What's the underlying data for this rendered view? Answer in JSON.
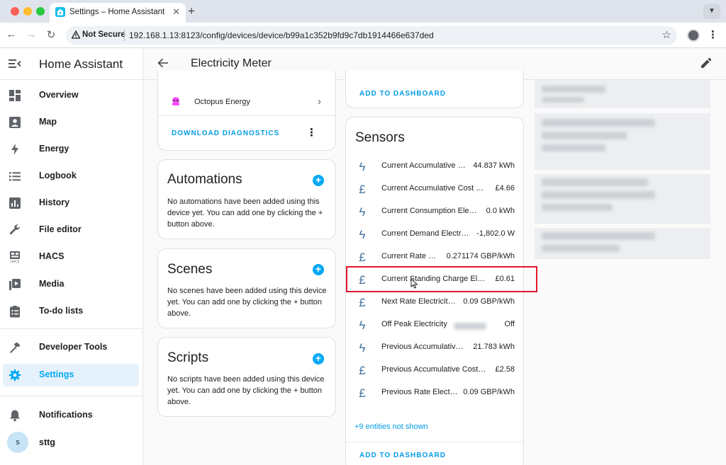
{
  "browser": {
    "tab_title": "Settings – Home Assistant",
    "new_tab": "+",
    "close_tab": "✕",
    "security_label": "Not Secure",
    "url": "192.168.1.13:8123/config/devices/device/b99a1c352b9fd9c7db1914466e637ded"
  },
  "sidebar": {
    "app_title": "Home Assistant",
    "items": [
      {
        "label": "Overview",
        "icon": "view-dashboard-icon"
      },
      {
        "label": "Map",
        "icon": "map-account-icon"
      },
      {
        "label": "Energy",
        "icon": "lightning-icon"
      },
      {
        "label": "Logbook",
        "icon": "format-list-icon"
      },
      {
        "label": "History",
        "icon": "chart-box-icon"
      },
      {
        "label": "File editor",
        "icon": "wrench-icon"
      },
      {
        "label": "HACS",
        "icon": "hacs-icon"
      },
      {
        "label": "Media",
        "icon": "play-box-multiple-icon"
      },
      {
        "label": "To-do lists",
        "icon": "clipboard-list-icon"
      }
    ],
    "developer_tools": "Developer Tools",
    "settings": "Settings",
    "notifications": "Notifications",
    "user_initial": "s",
    "user_name": "sttg"
  },
  "header": {
    "title": "Electricity Meter"
  },
  "device_card": {
    "integration": "Octopus Energy",
    "download_diagnostics": "DOWNLOAD DIAGNOSTICS"
  },
  "automations": {
    "title": "Automations",
    "text": "No automations have been added using this device yet. You can add one by clicking the + button above."
  },
  "scenes": {
    "title": "Scenes",
    "text": "No scenes have been added using this device yet. You can add one by clicking the + button above."
  },
  "scripts": {
    "title": "Scripts",
    "text": "No scripts have been added using this device yet. You can add one by clicking the + button above."
  },
  "top_card": {
    "add_to_dashboard": "ADD TO DASHBOARD"
  },
  "sensors": {
    "title": "Sensors",
    "rows": [
      {
        "icon": "lightning-icon",
        "name": "Current Accumulative …",
        "value": "44.837 kWh"
      },
      {
        "icon": "currency-gbp-icon",
        "name": "Current Accumulative Cost E…",
        "value": "£4.66"
      },
      {
        "icon": "lightning-icon",
        "name": "Current Consumption Elec…",
        "value": "0.0 kWh"
      },
      {
        "icon": "lightning-icon",
        "name": "Current Demand Electri…",
        "value": "-1,802.0 W"
      },
      {
        "icon": "currency-gbp-icon",
        "name": "Current Rate E…",
        "value": "0.271174 GBP/kWh"
      },
      {
        "icon": "currency-gbp-icon",
        "name": "Current Standing Charge Ele…",
        "value": "£0.61"
      },
      {
        "icon": "currency-gbp-icon",
        "name": "Next Rate Electricit…",
        "value": "0.09 GBP/kWh"
      },
      {
        "icon": "lightning-icon",
        "name": "Off Peak Electricity",
        "value": "Off"
      },
      {
        "icon": "lightning-icon",
        "name": "Previous Accumulativ…",
        "value": "21.783 kWh"
      },
      {
        "icon": "currency-gbp-icon",
        "name": "Previous Accumulative Cost …",
        "value": "£2.58"
      },
      {
        "icon": "currency-gbp-icon",
        "name": "Previous Rate Elect…",
        "value": "0.09 GBP/kWh"
      }
    ],
    "more_entities": "+9 entities not shown",
    "add_to_dashboard": "ADD TO DASHBOARD"
  },
  "colors": {
    "accent": "#03a9f4",
    "icon": "#44739e",
    "highlight": "#e3162c"
  }
}
